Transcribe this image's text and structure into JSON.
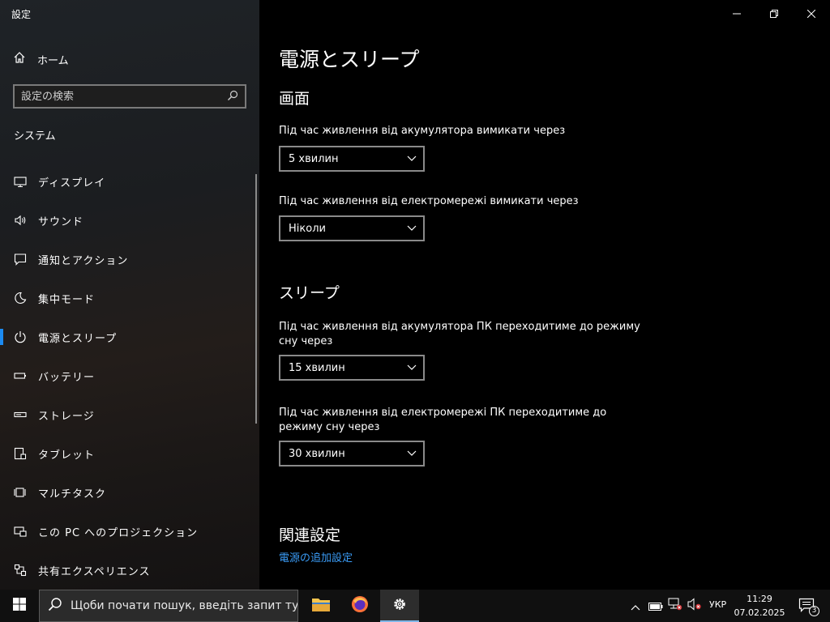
{
  "window": {
    "title": "設定"
  },
  "sidebar": {
    "home_label": "ホーム",
    "search_placeholder": "設定の検索",
    "section_title": "システム",
    "items": [
      {
        "label": "ディスプレイ",
        "icon": "display-icon"
      },
      {
        "label": "サウンド",
        "icon": "sound-icon"
      },
      {
        "label": "通知とアクション",
        "icon": "notification-icon"
      },
      {
        "label": "集中モード",
        "icon": "moon-icon"
      },
      {
        "label": "電源とスリープ",
        "icon": "power-icon",
        "active": true
      },
      {
        "label": "バッテリー",
        "icon": "battery-icon"
      },
      {
        "label": "ストレージ",
        "icon": "storage-icon"
      },
      {
        "label": "タブレット",
        "icon": "tablet-icon"
      },
      {
        "label": "マルチタスク",
        "icon": "multitask-icon"
      },
      {
        "label": "この PC へのプロジェクション",
        "icon": "projection-icon"
      },
      {
        "label": "共有エクスペリエンス",
        "icon": "shared-experience-icon"
      }
    ]
  },
  "main": {
    "title": "電源とスリープ",
    "screen": {
      "heading": "画面",
      "battery_label": "Під час живлення від акумулятора вимикати через",
      "battery_value": "5 хвилин",
      "plugged_label": "Під час живлення від електромережі вимикати через",
      "plugged_value": "Ніколи"
    },
    "sleep": {
      "heading": "スリープ",
      "battery_label": "Під час живлення від акумулятора ПК переходитиме до режиму сну через",
      "battery_value": "15 хвилин",
      "plugged_label": "Під час живлення від електромережі ПК переходитиме до режиму сну через",
      "plugged_value": "30 хвилин"
    },
    "related": {
      "heading": "関連設定",
      "link": "電源の追加設定"
    }
  },
  "taskbar": {
    "search_text": "Щоби почати пошук, введіть запит тут",
    "language": "УКР",
    "time": "11:29",
    "date": "07.02.2025",
    "notification_count": "3"
  },
  "colors": {
    "accent": "#1c8bf2",
    "link": "#3a9bf5"
  }
}
